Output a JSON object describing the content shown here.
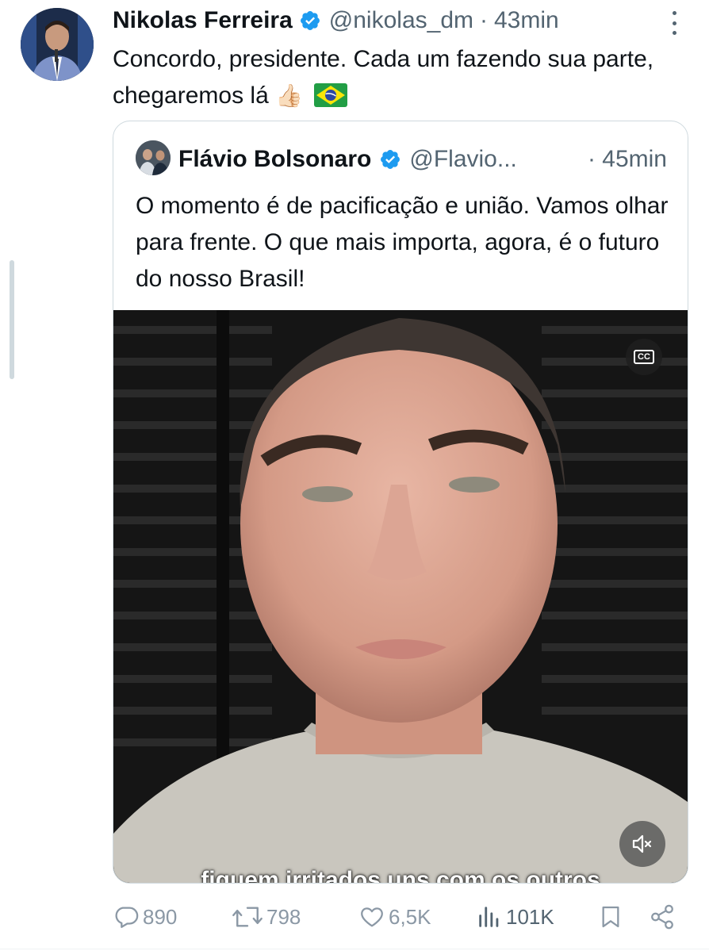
{
  "tweet": {
    "author_name": "Nikolas Ferreira",
    "handle": "@nikolas_dm",
    "separator": "·",
    "time": "43min",
    "text": "Concordo, presidente. Cada um fazendo sua parte, chegaremos lá",
    "emoji_thumbs": "👍🏻",
    "emoji_flag_name": "brazil-flag-icon"
  },
  "quote": {
    "author_name": "Flávio Bolsonaro",
    "handle": "@Flavio...",
    "separator": "·",
    "time": "45min",
    "text": "O momento é de pacificação e união. Vamos olhar para frente. O que mais importa, agora, é o futuro do nosso Brasil!",
    "video": {
      "subtitle": "fiquem irritados uns com os outros",
      "cc_label": "CC"
    }
  },
  "actions": {
    "replies": "890",
    "retweets": "798",
    "likes": "6,5K",
    "views": "101K"
  },
  "colors": {
    "verified": "#1d9bf0",
    "text": "#0f1419",
    "muted": "#536471",
    "action_gray": "#8b98a5",
    "border": "#cfd9de"
  }
}
